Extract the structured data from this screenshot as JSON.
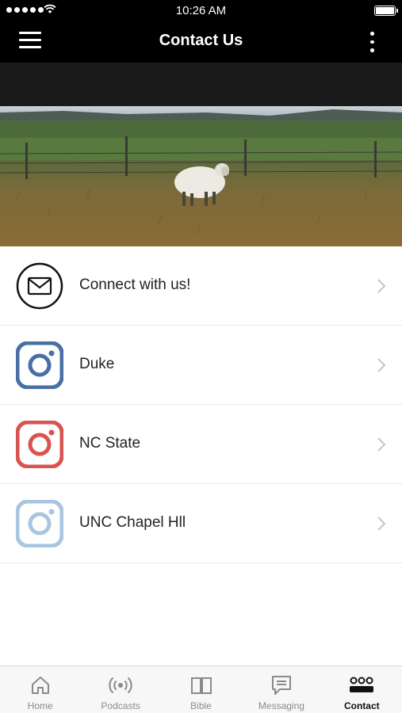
{
  "status_bar": {
    "time": "10:26 AM",
    "battery_level": 1.0
  },
  "header": {
    "title": "Contact Us",
    "menu_icon": "hamburger-icon",
    "more_icon": "more-vertical-icon"
  },
  "hero": {
    "image_icon": "sheep-field-photo"
  },
  "contacts": [
    {
      "label": "Connect with us!",
      "icon": "mail-icon",
      "color": "#111111"
    },
    {
      "label": "Duke",
      "icon": "instagram-icon",
      "color": "#4a6fa5"
    },
    {
      "label": "NC State",
      "icon": "instagram-icon",
      "color": "#d9534f"
    },
    {
      "label": "UNC Chapel Hll",
      "icon": "instagram-icon",
      "color": "#a9c6e0"
    }
  ],
  "tabs": [
    {
      "label": "Home",
      "icon": "home-icon",
      "active": false
    },
    {
      "label": "Podcasts",
      "icon": "podcast-icon",
      "active": false
    },
    {
      "label": "Bible",
      "icon": "book-icon",
      "active": false
    },
    {
      "label": "Messaging",
      "icon": "message-icon",
      "active": false
    },
    {
      "label": "Contact",
      "icon": "people-icon",
      "active": true
    }
  ],
  "colors": {
    "bar_background": "#000000",
    "subheader_background": "#1a1a1a",
    "tab_inactive": "#8a8a8a",
    "tab_active": "#111111"
  }
}
